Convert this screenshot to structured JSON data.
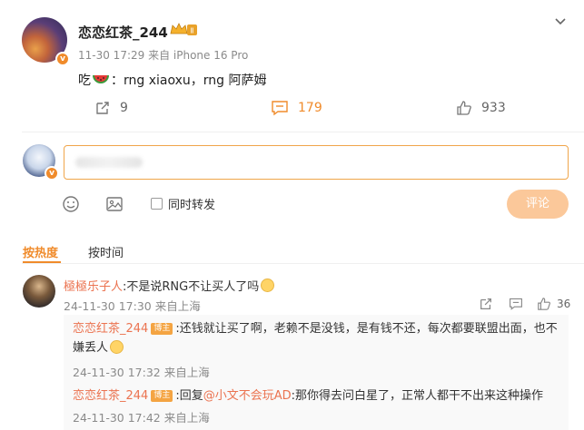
{
  "post": {
    "username": "恋恋红茶_244",
    "meta": "11-30 17:29 来自 iPhone 16 Pro",
    "body_prefix": "吃",
    "body_text": "：rng xiaoxu，rng 阿萨姆",
    "badge_text": "Ⅱ",
    "v_mark": "v",
    "repost_count": "9",
    "comment_count": "179",
    "like_count": "933"
  },
  "composer": {
    "sync_label": "同时转发",
    "submit_label": "评论"
  },
  "tabs": {
    "hot": "按热度",
    "time": "按时间"
  },
  "comment": {
    "nick": "極極乐子人",
    "text": ":不是说RNG不让买人了吗",
    "meta": "24-11-30 17:30 来自上海",
    "like_count": "36"
  },
  "replies": [
    {
      "nick": "恋恋红茶_244",
      "tag": "博主",
      "text1": ":还钱就让买了啊，老赖不是没钱，是有钱不还，每次都要联盟出面，也不",
      "text2": "嫌丢人",
      "meta": "24-11-30 17:32 来自上海"
    },
    {
      "nick": "恋恋红茶_244",
      "tag": "博主",
      "text_pre": ":回复",
      "mention": "@小文不会玩AD",
      "text_post": ":那你得去问白星了，正常人都干不出来这种操作",
      "meta": "24-11-30 17:42 来自上海"
    }
  ],
  "colors": {
    "accent": "#f08b2b",
    "nick": "#eb7350",
    "submit_disabled": "#fbc89a"
  }
}
